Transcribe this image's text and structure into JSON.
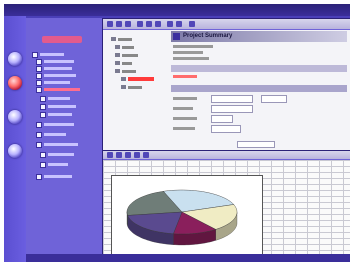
{
  "window": {
    "title": "",
    "brand_color": "#4a3fb8",
    "accent": "#ff3b3b"
  },
  "dock": {
    "buttons": [
      "home-icon",
      "doc-icon",
      "chart-icon",
      "settings-icon"
    ]
  },
  "tree": {
    "header": "",
    "items": [
      "",
      "",
      "",
      "",
      "",
      "",
      "",
      "",
      "",
      "",
      "",
      "",
      "",
      "",
      ""
    ]
  },
  "detail": {
    "title": "Project Summary"
  },
  "chart_data": {
    "type": "pie",
    "title": "",
    "categories": [
      "",
      "",
      "",
      "",
      ""
    ],
    "values": [
      22,
      25,
      20,
      13,
      20
    ],
    "colors": [
      "#6f7d78",
      "#c9e0ef",
      "#f0ecc4",
      "#8a1f5c",
      "#5a4a8f"
    ]
  }
}
